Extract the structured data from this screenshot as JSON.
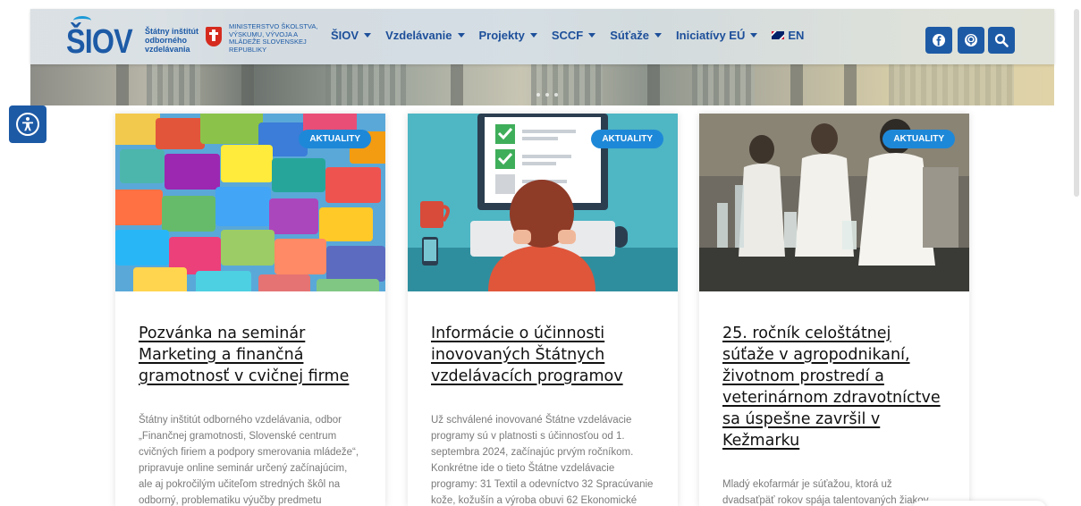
{
  "header": {
    "logo_text": "ŠIOV",
    "logo_subtitle": "Štátny inštitút odborného vzdelávania",
    "ministry_text": "MINISTERSTVO ŠKOLSTVA, VÝSKUMU, VÝVOJA A MLÁDEŽE SLOVENSKEJ REPUBLIKY",
    "nav": [
      {
        "label": "ŠIOV"
      },
      {
        "label": "Vzdelávanie"
      },
      {
        "label": "Projekty"
      },
      {
        "label": "SCCF"
      },
      {
        "label": "Súťaže"
      },
      {
        "label": "Iniciatívy EÚ"
      }
    ],
    "lang_label": "EN",
    "social": [
      {
        "icon": "facebook-icon"
      },
      {
        "icon": "podcast-icon"
      },
      {
        "icon": "search-icon"
      }
    ],
    "brand_color": "#1d5aa6"
  },
  "cards": [
    {
      "badge": "AKTUALITY",
      "title": "Pozvánka na seminár Marketing a finančná gramotnosť v cvičnej firme",
      "excerpt": "Štátny inštitút odborného vzdelávania, odbor „Finančnej gramotnosti, Slovenské centrum cvičných firiem a podpory smerovania mládeže“, pripravuje online seminár určený začínajúcim, ale aj pokročilým učiteľom stredných škôl na odborný, problematiku výučby predmetu"
    },
    {
      "badge": "AKTUALITY",
      "title": "Informácie o účinnosti inovovaných Štátnych vzdelávacích programov",
      "excerpt": "Už schválené inovované Štátne vzdelávacie programy sú v platnosti s účinnosťou od 1. septembra 2024, začínajúc prvým ročníkom. Konkrétne ide o tieto Štátne vzdelávacie programy: 31 Textil a odevníctvo 32 Spracúvanie kože, kožušín a výroba obuvi 62 Ekonomické"
    },
    {
      "badge": "AKTUALITY",
      "title": "25. ročník celoštátnej súťaže v agropodnikaní, životnom prostredí a veterinárnom zdravotníctve sa úspešne završil v Kežmarku",
      "excerpt": "Mladý ekofarmár je súťažou, ktorá už dvadsaťpäť rokov spája talentovaných žiakov stredných odborných škôl so"
    }
  ]
}
